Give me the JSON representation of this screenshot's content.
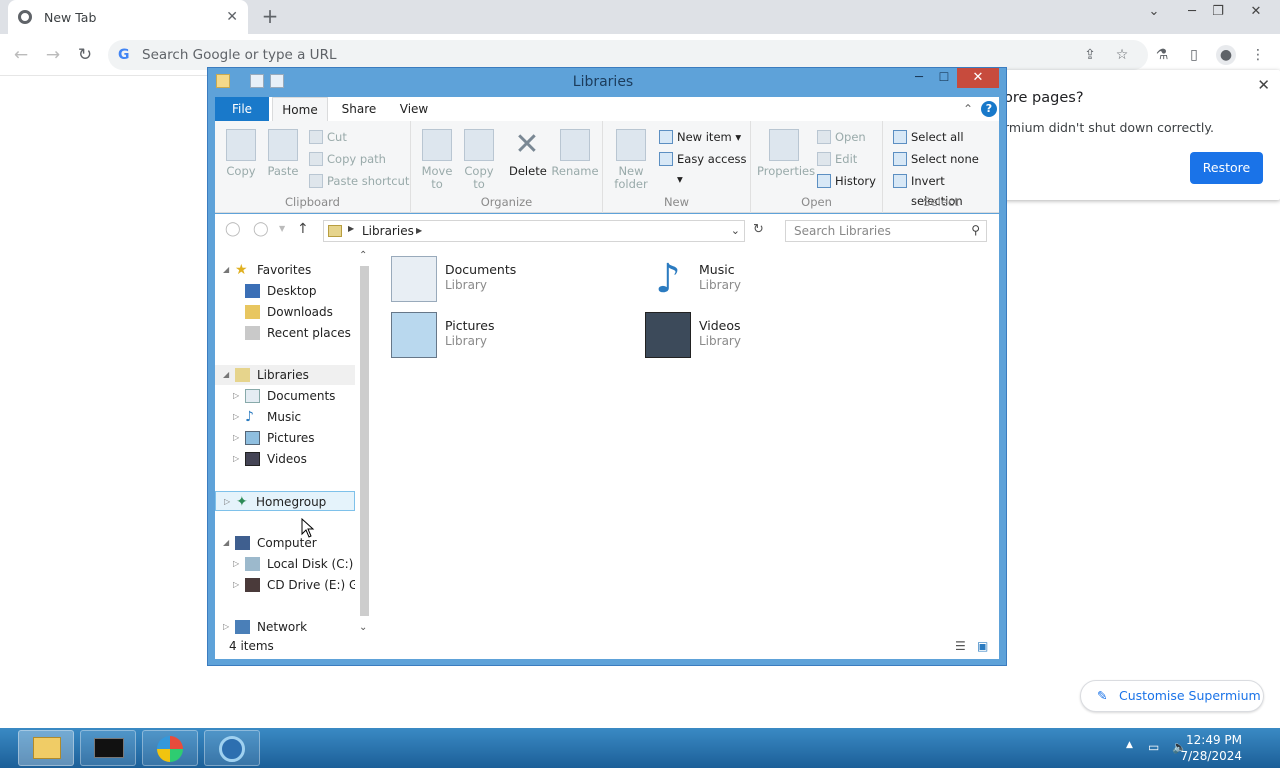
{
  "browser": {
    "tab_title": "New Tab",
    "new_tab_symbol": "+",
    "omnibox_placeholder": "Search Google or type a URL",
    "restore_prompt": {
      "heading": "ore pages?",
      "message": "rmium didn't shut down correctly.",
      "button": "Restore"
    },
    "customise_label": "Customise Supermium"
  },
  "explorer": {
    "title": "Libraries",
    "ribbon_tabs": [
      "File",
      "Home",
      "Share",
      "View"
    ],
    "clipboard": {
      "copy": "Copy",
      "paste": "Paste",
      "cut": "Cut",
      "copy_path": "Copy path",
      "paste_shortcut": "Paste shortcut",
      "label": "Clipboard"
    },
    "organize": {
      "move_to": "Move to",
      "copy_to": "Copy to",
      "delete": "Delete",
      "rename": "Rename",
      "label": "Organize"
    },
    "new": {
      "new_folder": "New folder",
      "new_item": "New item",
      "easy_access": "Easy access",
      "label": "New"
    },
    "open": {
      "properties": "Properties",
      "open": "Open",
      "edit": "Edit",
      "history": "History",
      "label": "Open"
    },
    "select": {
      "select_all": "Select all",
      "select_none": "Select none",
      "invert": "Invert selection",
      "label": "Select"
    },
    "address_path": "Libraries",
    "search_placeholder": "Search Libraries",
    "nav": {
      "favorites": "Favorites",
      "desktop": "Desktop",
      "downloads": "Downloads",
      "recent": "Recent places",
      "libraries": "Libraries",
      "documents": "Documents",
      "music": "Music",
      "pictures": "Pictures",
      "videos": "Videos",
      "homegroup": "Homegroup",
      "computer": "Computer",
      "local_disk": "Local Disk (C:)",
      "cd_drive": "CD Drive (E:) GSP",
      "network": "Network"
    },
    "items": [
      {
        "name": "Documents",
        "type": "Library"
      },
      {
        "name": "Music",
        "type": "Library"
      },
      {
        "name": "Pictures",
        "type": "Library"
      },
      {
        "name": "Videos",
        "type": "Library"
      }
    ],
    "status": "4 items"
  },
  "taskbar": {
    "time": "12:49 PM",
    "date": "7/28/2024"
  },
  "colors": {
    "accent": "#1a73e8",
    "file_tab": "#1979ca",
    "close": "#c74b3d"
  }
}
